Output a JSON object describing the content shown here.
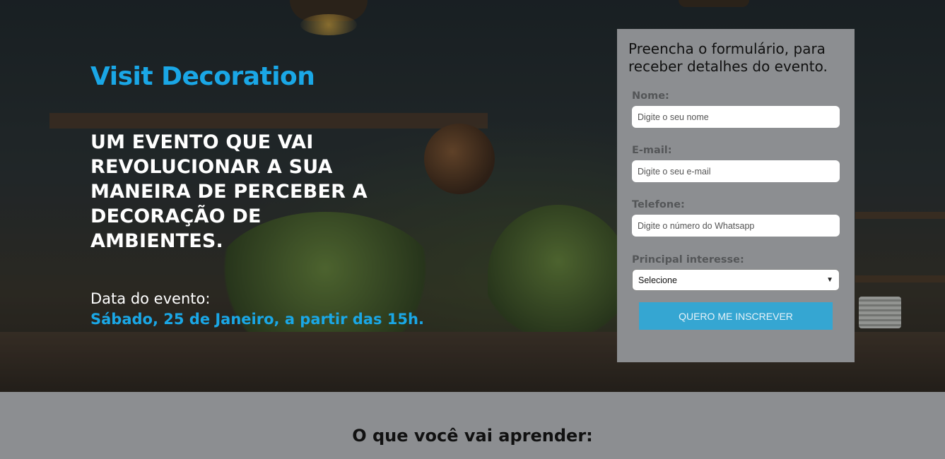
{
  "hero": {
    "brand": "Visit Decoration",
    "headline": "UM EVENTO QUE VAI REVOLUCIONAR A SUA MANEIRA DE PERCEBER A DECORAÇÃO DE AMBIENTES.",
    "date_label": "Data do evento:",
    "date_value": "Sábado, 25 de Janeiro, a partir das 15h."
  },
  "form": {
    "title": "Preencha o formulário, para receber detalhes do evento.",
    "fields": [
      {
        "label": "Nome:",
        "placeholder": "Digite o seu nome"
      },
      {
        "label": "E-mail:",
        "placeholder": "Digite o seu e-mail"
      },
      {
        "label": "Telefone:",
        "placeholder": "Digite o número do Whatsapp"
      }
    ],
    "interest_label": "Principal interesse:",
    "interest_selected": "Selecione",
    "submit_label": "QUERO ME INSCREVER"
  },
  "learn_section": {
    "title": "O que você vai aprender:"
  },
  "colors": {
    "accent": "#1aa7e6",
    "button": "#35a6d2",
    "form_bg": "#8c8e91"
  }
}
